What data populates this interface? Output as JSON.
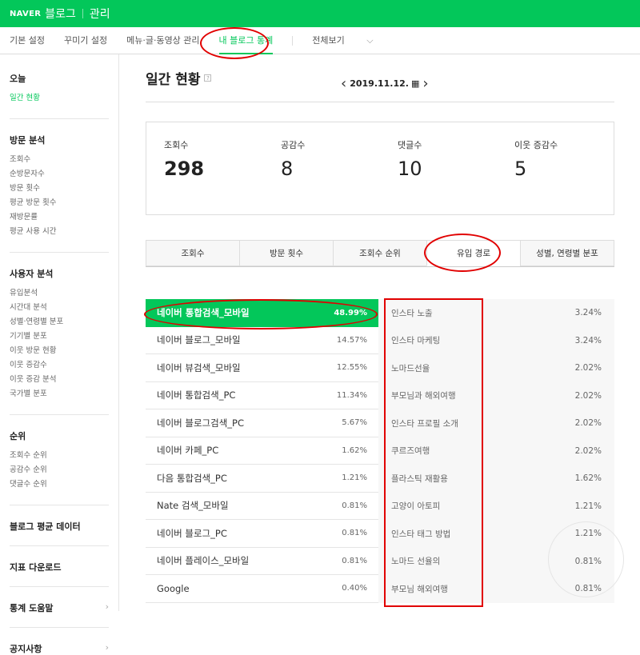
{
  "header": {
    "logo": "NAVER",
    "blog": "블로그",
    "admin": "관리"
  },
  "nav": {
    "items": [
      "기본 설정",
      "꾸미기 설정",
      "메뉴·글·동영상 관리",
      "내 블로그 통계"
    ],
    "all": "전체보기"
  },
  "sidebar": {
    "today": {
      "title": "오늘",
      "items": [
        "일간 현황"
      ]
    },
    "visit": {
      "title": "방문 분석",
      "items": [
        "조회수",
        "순방문자수",
        "방문 횟수",
        "평균 방문 횟수",
        "재방문률",
        "평균 사용 시간"
      ]
    },
    "user": {
      "title": "사용자 분석",
      "items": [
        "유입분석",
        "시간대 분석",
        "성별·연령별 분포",
        "기기별 분포",
        "이웃 방문 현황",
        "이웃 증감수",
        "이웃 증감 분석",
        "국가별 분포"
      ]
    },
    "rank": {
      "title": "순위",
      "items": [
        "조회수 순위",
        "공감수 순위",
        "댓글수 순위"
      ]
    },
    "links": [
      "블로그 평균 데이터",
      "지표 다운로드",
      "통계 도움말",
      "공지사항"
    ]
  },
  "main": {
    "title": "일간 현황",
    "help": "?",
    "date": "2019.11.12.",
    "stats": [
      {
        "label": "조회수",
        "value": "298"
      },
      {
        "label": "공감수",
        "value": "8"
      },
      {
        "label": "댓글수",
        "value": "10"
      },
      {
        "label": "이웃 증감수",
        "value": "5"
      }
    ],
    "tabs": [
      "조회수",
      "방문 횟수",
      "조회수 순위",
      "유입 경로",
      "성별, 연령별 분포"
    ],
    "sources": [
      {
        "name": "네이버 통합검색_모바일",
        "pct": "48.99%"
      },
      {
        "name": "네이버 블로그_모바일",
        "pct": "14.57%"
      },
      {
        "name": "네이버 뷰검색_모바일",
        "pct": "12.55%"
      },
      {
        "name": "네이버 통합검색_PC",
        "pct": "11.34%"
      },
      {
        "name": "네이버 블로그검색_PC",
        "pct": "5.67%"
      },
      {
        "name": "네이버 카페_PC",
        "pct": "1.62%"
      },
      {
        "name": "다음 통합검색_PC",
        "pct": "1.21%"
      },
      {
        "name": "Nate 검색_모바일",
        "pct": "0.81%"
      },
      {
        "name": "네이버 블로그_PC",
        "pct": "0.81%"
      },
      {
        "name": "네이버 플레이스_모바일",
        "pct": "0.81%"
      },
      {
        "name": "Google",
        "pct": "0.40%"
      }
    ],
    "keywords": [
      {
        "name": "인스타 노출",
        "pct": "3.24%"
      },
      {
        "name": "인스타 마케팅",
        "pct": "3.24%"
      },
      {
        "name": "노마드선율",
        "pct": "2.02%"
      },
      {
        "name": "부모님과 해외여행",
        "pct": "2.02%"
      },
      {
        "name": "인스타 프로필 소개",
        "pct": "2.02%"
      },
      {
        "name": "쿠르즈여행",
        "pct": "2.02%"
      },
      {
        "name": "플라스틱 재활용",
        "pct": "1.62%"
      },
      {
        "name": "고양이 아토피",
        "pct": "1.21%"
      },
      {
        "name": "인스타 태그 방법",
        "pct": "1.21%"
      },
      {
        "name": "노마드 선율의",
        "pct": "0.81%"
      },
      {
        "name": "부모님 해외여행",
        "pct": "0.81%"
      }
    ]
  }
}
